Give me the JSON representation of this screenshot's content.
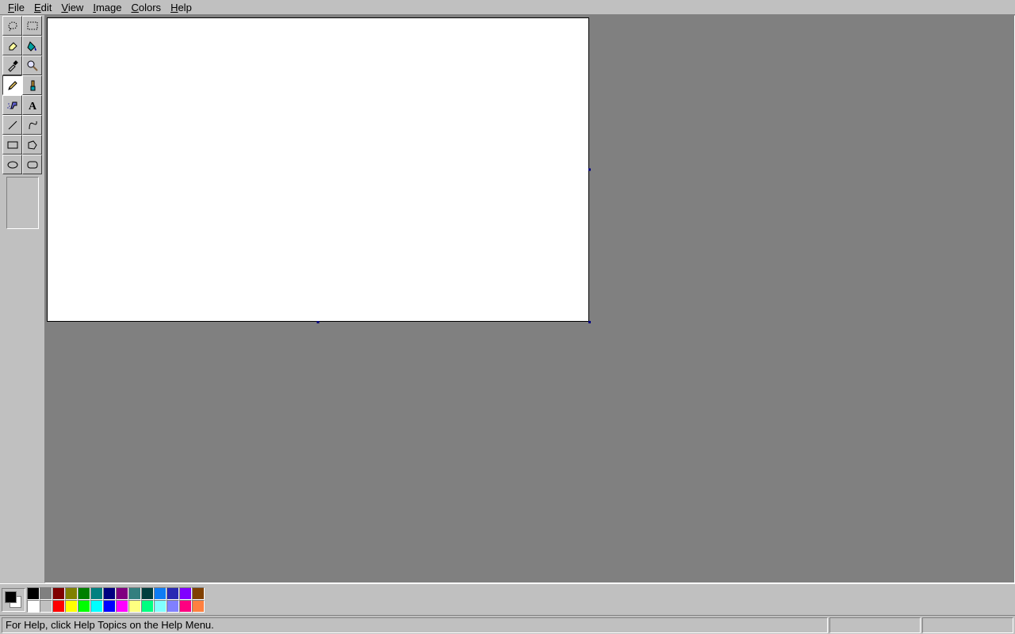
{
  "menu": {
    "file": "File",
    "edit": "Edit",
    "view": "View",
    "image": "Image",
    "colors": "Colors",
    "help": "Help"
  },
  "tools": {
    "free_select": "free-form-select",
    "rect_select": "rectangle-select",
    "eraser": "eraser",
    "fill": "fill",
    "picker": "color-picker",
    "magnifier": "magnifier",
    "pencil": "pencil",
    "brush": "brush",
    "airbrush": "airbrush",
    "text": "text",
    "line": "line",
    "curve": "curve",
    "rectangle": "rectangle",
    "polygon": "polygon",
    "ellipse": "ellipse",
    "rounded_rect": "rounded-rectangle"
  },
  "active_tool": "pencil",
  "current_colors": {
    "fg": "#000000",
    "bg": "#ffffff"
  },
  "palette": [
    "#000000",
    "#808080",
    "#800000",
    "#808000",
    "#008000",
    "#008080",
    "#000080",
    "#800080",
    "#337f7f",
    "#003e3e",
    "#0f7cf4",
    "#2929b3",
    "#8000ff",
    "#804000",
    "#ffffff",
    "#c0c0c0",
    "#ff0000",
    "#ffff00",
    "#00ff00",
    "#00ffff",
    "#0000ff",
    "#ff00ff",
    "#ffff80",
    "#00ff80",
    "#80ffff",
    "#8080ff",
    "#ff0080",
    "#ff8040"
  ],
  "status": {
    "help": "For Help, click Help Topics on the Help Menu."
  }
}
